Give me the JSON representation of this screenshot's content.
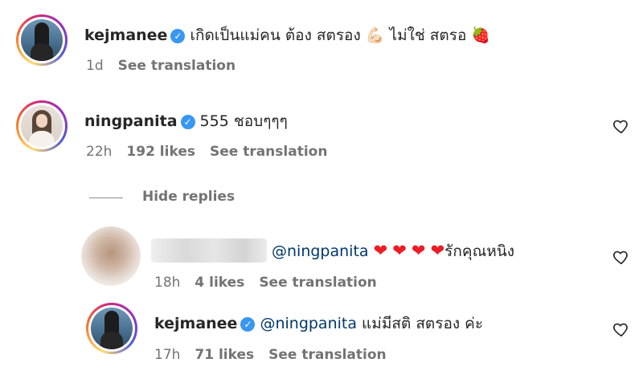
{
  "comments": [
    {
      "username": "kejmanee",
      "verified": true,
      "text_1": "เกิดเป็นแม่คน ต้อง สตรอง",
      "emoji_muscle": "💪🏻",
      "text_2": "ไม่ใช่ สตรอ",
      "emoji_strawberry": "🍓",
      "time": "1d",
      "translate": "See translation"
    },
    {
      "username": "ningpanita",
      "verified": true,
      "text": "555 ชอบๆๆๆ",
      "time": "22h",
      "likes": "192 likes",
      "translate": "See translation",
      "hide_replies": "Hide replies"
    }
  ],
  "replies": [
    {
      "mention": "@ningpanita",
      "hearts": [
        "❤",
        "❤",
        "❤",
        "❤"
      ],
      "text": "รักคุณหนิง",
      "time": "18h",
      "likes": "4 likes",
      "translate": "See translation"
    },
    {
      "username": "kejmanee",
      "verified": true,
      "mention": "@ningpanita",
      "text": "แม่มีสติ สตรอง ค่ะ",
      "time": "17h",
      "likes": "71 likes",
      "translate": "See translation"
    }
  ],
  "icons": {
    "verified": "verified-badge-icon",
    "like": "heart-outline-icon"
  },
  "colors": {
    "verified": "#3897f0",
    "mention": "#00376b",
    "meta": "#737373"
  }
}
